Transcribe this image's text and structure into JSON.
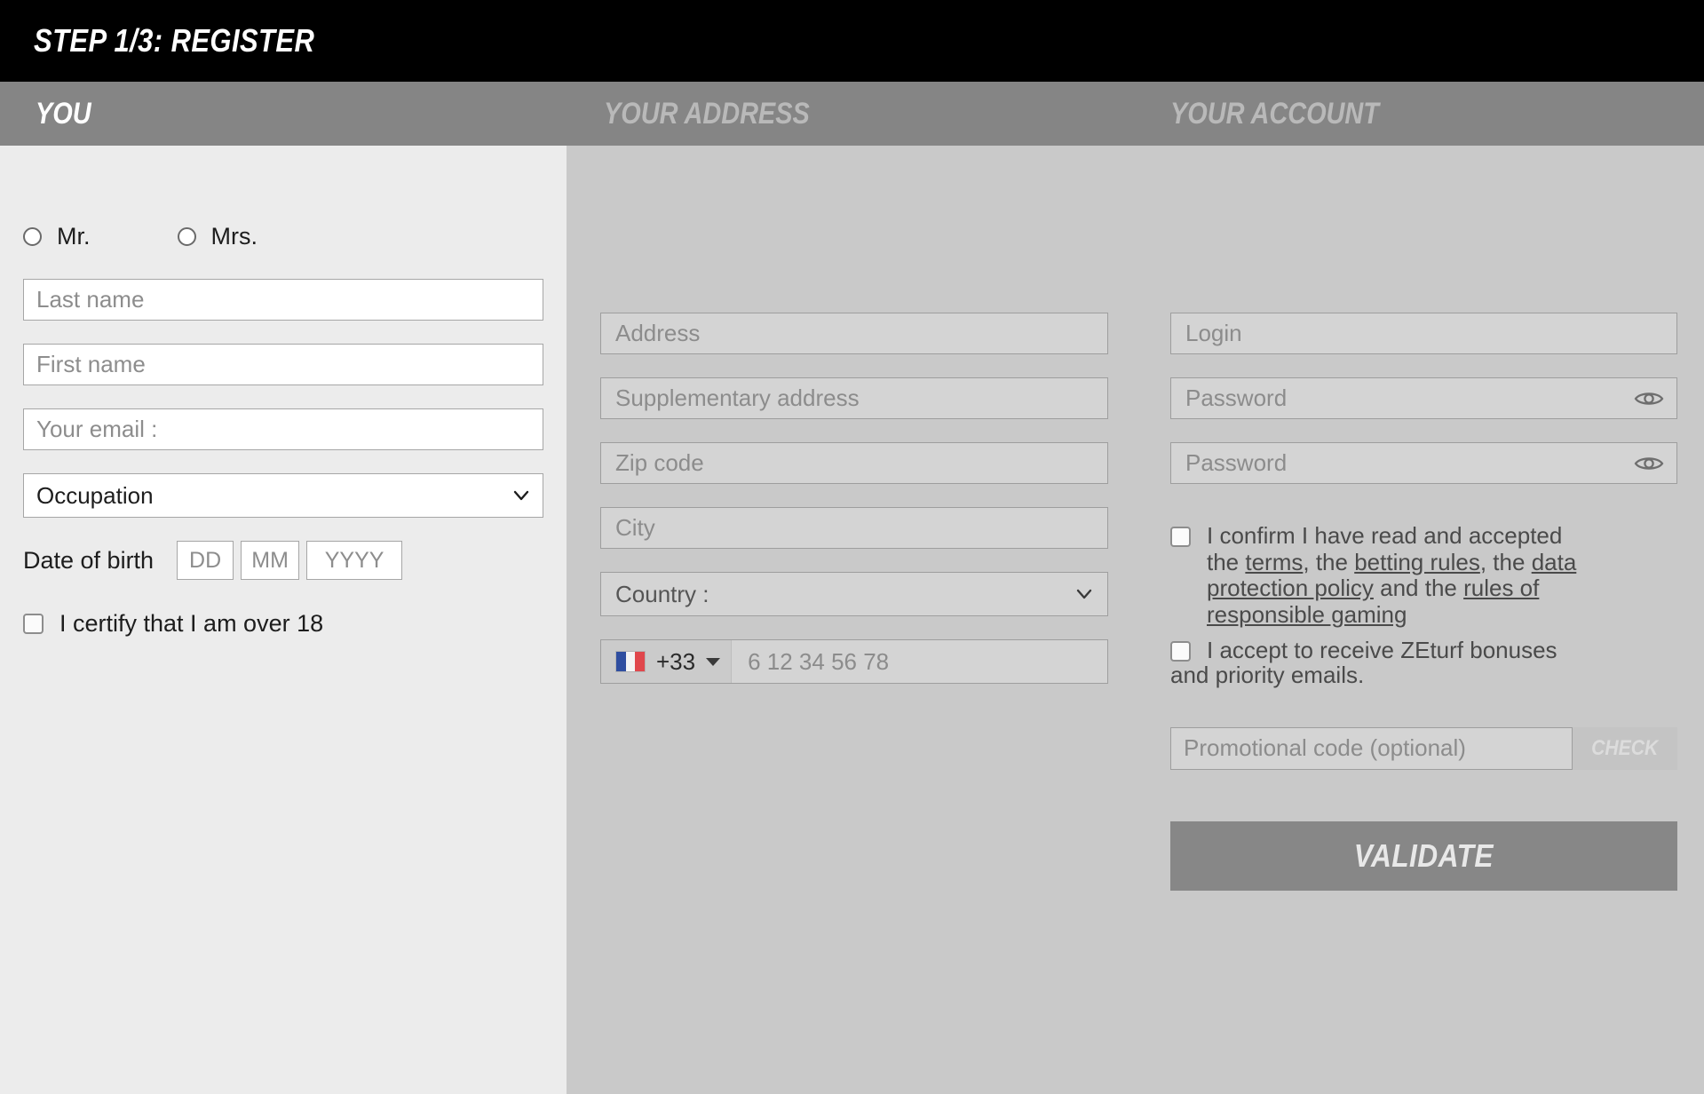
{
  "header": {
    "step_title": "STEP 1/3: REGISTER"
  },
  "tabs": [
    {
      "label": "YOU",
      "active": true
    },
    {
      "label": "YOUR ADDRESS",
      "active": false
    },
    {
      "label": "YOUR ACCOUNT",
      "active": false
    }
  ],
  "you": {
    "gender": {
      "mr_label": "Mr.",
      "mrs_label": "Mrs.",
      "selected": ""
    },
    "last_name_placeholder": "Last name",
    "first_name_placeholder": "First name",
    "email_placeholder": "Your email :",
    "occupation_value": "Occupation",
    "dob_label": "Date of birth",
    "dob_day_placeholder": "DD",
    "dob_month_placeholder": "MM",
    "dob_year_placeholder": "YYYY",
    "over18_label": "I certify that I am over 18"
  },
  "address": {
    "address_placeholder": "Address",
    "supplementary_placeholder": "Supplementary address",
    "zip_placeholder": "Zip code",
    "city_placeholder": "City",
    "country_value": "Country :",
    "phone_country_flag": "france-flag",
    "phone_code": "+33",
    "phone_placeholder": "6 12 34 56 78"
  },
  "account": {
    "login_placeholder": "Login",
    "password_placeholder": "Password",
    "password_confirm_placeholder": "Password",
    "show_password_icon": "eye-icon",
    "terms": {
      "part1": "I confirm I have read and accepted the ",
      "link1": "terms",
      "part2": ", the ",
      "link2": "betting rules",
      "part3": ", the ",
      "link3": "data protection policy",
      "part4": " and the ",
      "link4": "rules of responsible gaming"
    },
    "optin_line1": "I accept to receive ZEturf bonuses",
    "optin_line2": "and priority emails.",
    "promo_placeholder": "Promotional code (optional)",
    "promo_check_label": "CHECK",
    "validate_label": "VALIDATE"
  },
  "colors": {
    "header_bg": "#000000",
    "tab_bg": "#858585",
    "active_column_bg": "#ececec",
    "inactive_column_bg": "#c9c9c9",
    "button_bg": "#878787"
  }
}
